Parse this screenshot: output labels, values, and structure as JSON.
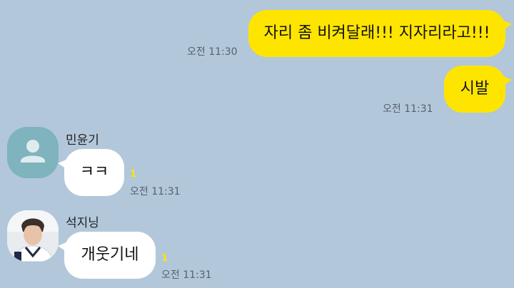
{
  "colors": {
    "background": "#b2c7da",
    "my_bubble": "#fee500",
    "their_bubble": "#ffffff",
    "unread_count": "#fee500",
    "default_avatar": "#7fb3bd"
  },
  "messages": [
    {
      "direction": "outgoing",
      "text": "자리 좀 비켜달래!!! 지자리라고!!!",
      "time": "오전 11:30"
    },
    {
      "direction": "outgoing",
      "text": "시발",
      "time": "오전 11:31"
    },
    {
      "direction": "incoming",
      "sender": "민윤기",
      "avatar_icon": "default-profile-icon",
      "text": "ㅋㅋ",
      "unread": "1",
      "time": "오전 11:31"
    },
    {
      "direction": "incoming",
      "sender": "석지닝",
      "avatar_icon": "profile-photo",
      "text": "개웃기네",
      "unread": "1",
      "time": "오전 11:31"
    }
  ]
}
